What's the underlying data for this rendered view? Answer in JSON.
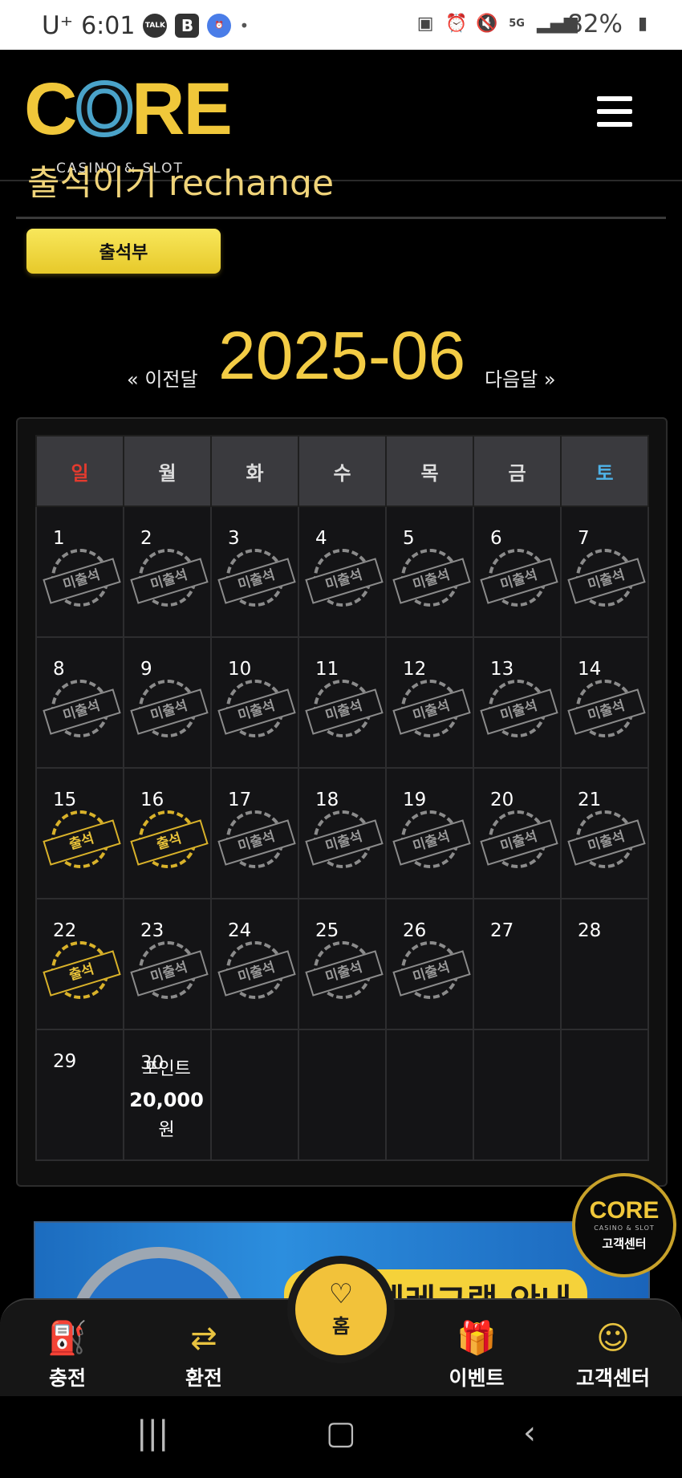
{
  "status_bar": {
    "carrier": "U⁺",
    "time": "6:01",
    "notification_badges": [
      "TALK",
      "B",
      "alarm-icon"
    ],
    "battery": "82%",
    "icons": [
      "sim-icon",
      "alarm-icon",
      "mute-icon",
      "5g-icon",
      "signal-icon",
      "battery-icon"
    ]
  },
  "header": {
    "logo_text": "CORE",
    "logo_sub": "CASINO & SLOT"
  },
  "page": {
    "title": "출석이기 rechange",
    "attendance_button": "출석부"
  },
  "month_nav": {
    "prev": "« 이전달",
    "current": "2025-06",
    "next": "다음달 »"
  },
  "calendar": {
    "weekdays": [
      "일",
      "월",
      "화",
      "수",
      "목",
      "금",
      "토"
    ],
    "stamp_absent": "미출석",
    "stamp_present": "출석",
    "weeks": [
      [
        {
          "d": "1",
          "s": "absent"
        },
        {
          "d": "2",
          "s": "absent"
        },
        {
          "d": "3",
          "s": "absent"
        },
        {
          "d": "4",
          "s": "absent"
        },
        {
          "d": "5",
          "s": "absent"
        },
        {
          "d": "6",
          "s": "absent"
        },
        {
          "d": "7",
          "s": "absent"
        }
      ],
      [
        {
          "d": "8",
          "s": "absent"
        },
        {
          "d": "9",
          "s": "absent"
        },
        {
          "d": "10",
          "s": "absent"
        },
        {
          "d": "11",
          "s": "absent"
        },
        {
          "d": "12",
          "s": "absent"
        },
        {
          "d": "13",
          "s": "absent"
        },
        {
          "d": "14",
          "s": "absent"
        }
      ],
      [
        {
          "d": "15",
          "s": "present"
        },
        {
          "d": "16",
          "s": "present"
        },
        {
          "d": "17",
          "s": "absent"
        },
        {
          "d": "18",
          "s": "absent"
        },
        {
          "d": "19",
          "s": "absent"
        },
        {
          "d": "20",
          "s": "absent"
        },
        {
          "d": "21",
          "s": "absent"
        }
      ],
      [
        {
          "d": "22",
          "s": "present"
        },
        {
          "d": "23",
          "s": "absent"
        },
        {
          "d": "24",
          "s": "absent"
        },
        {
          "d": "25",
          "s": "absent"
        },
        {
          "d": "26",
          "s": "absent"
        },
        {
          "d": "27",
          "s": "none"
        },
        {
          "d": "28",
          "s": "none"
        }
      ],
      [
        {
          "d": "29",
          "s": "none"
        },
        {
          "d": "30",
          "s": "point"
        },
        {
          "d": "",
          "s": "empty"
        },
        {
          "d": "",
          "s": "empty"
        },
        {
          "d": "",
          "s": "empty"
        },
        {
          "d": "",
          "s": "empty"
        },
        {
          "d": "",
          "s": "empty"
        }
      ]
    ],
    "point_note": {
      "line1": "포인트",
      "line2": "20,000",
      "line3": "원"
    }
  },
  "banner": {
    "text": "코어 텔레그램 안내"
  },
  "floating_support": {
    "logo": "CORE",
    "sub": "CASINO & SLOT",
    "label": "고객센터"
  },
  "bottom_nav": {
    "items": [
      {
        "label": "충전",
        "icon": "charge-icon"
      },
      {
        "label": "환전",
        "icon": "exchange-icon"
      },
      {
        "label": "홈",
        "icon": "home-icon"
      },
      {
        "label": "이벤트",
        "icon": "gift-icon"
      },
      {
        "label": "고객센터",
        "icon": "support-icon"
      }
    ]
  },
  "colors": {
    "accent": "#f2c23a",
    "sunday": "#e33a2e",
    "saturday": "#4fb3e9",
    "background": "#000000"
  }
}
